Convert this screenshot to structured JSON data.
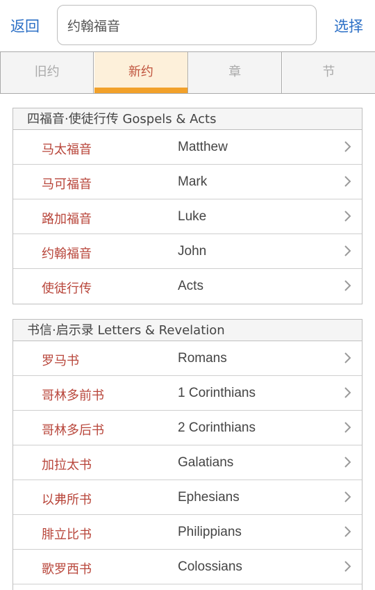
{
  "header": {
    "back_label": "返回",
    "search_value": "约翰福音",
    "select_label": "选择"
  },
  "tabs": [
    {
      "label": "旧约",
      "active": false
    },
    {
      "label": "新约",
      "active": true
    },
    {
      "label": "章",
      "active": false
    },
    {
      "label": "节",
      "active": false
    }
  ],
  "colors": {
    "accent": "#f2a12a",
    "link": "#2b6fc6",
    "book_name": "#b8453a"
  },
  "sections": [
    {
      "title": "四福音·使徒行传 Gospels & Acts",
      "books": [
        {
          "zh": "马太福音",
          "en": "Matthew"
        },
        {
          "zh": "马可福音",
          "en": "Mark"
        },
        {
          "zh": "路加福音",
          "en": "Luke"
        },
        {
          "zh": "约翰福音",
          "en": "John"
        },
        {
          "zh": "使徒行传",
          "en": "Acts"
        }
      ]
    },
    {
      "title": "书信·启示录 Letters & Revelation",
      "books": [
        {
          "zh": "罗马书",
          "en": "Romans"
        },
        {
          "zh": "哥林多前书",
          "en": "1 Corinthians"
        },
        {
          "zh": "哥林多后书",
          "en": "2 Corinthians"
        },
        {
          "zh": "加拉太书",
          "en": "Galatians"
        },
        {
          "zh": "以弗所书",
          "en": "Ephesians"
        },
        {
          "zh": "腓立比书",
          "en": "Philippians"
        },
        {
          "zh": "歌罗西书",
          "en": "Colossians"
        }
      ]
    }
  ],
  "row_icon": "chevron-right-icon"
}
